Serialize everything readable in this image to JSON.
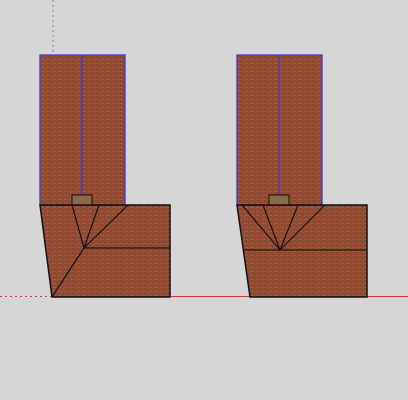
{
  "app": {
    "type": "3d-modeling-viewport"
  },
  "scene": {
    "background_color": "#d6d6d6",
    "brick_color": "#a6583a",
    "mortar_color": "#6f3824",
    "edge_color": "#111111",
    "selected_edge_color": "#3b3bd6",
    "cap_color": "#8a6a4a",
    "axes": {
      "red": "#cc3b2e",
      "green": "#38b84a"
    },
    "objects": [
      {
        "name": "left-chimney-assembly",
        "parts": [
          "chimney-stack",
          "stack-cap",
          "firebox-base"
        ]
      },
      {
        "name": "right-chimney-assembly",
        "parts": [
          "chimney-stack",
          "stack-cap",
          "firebox-base"
        ]
      }
    ]
  }
}
